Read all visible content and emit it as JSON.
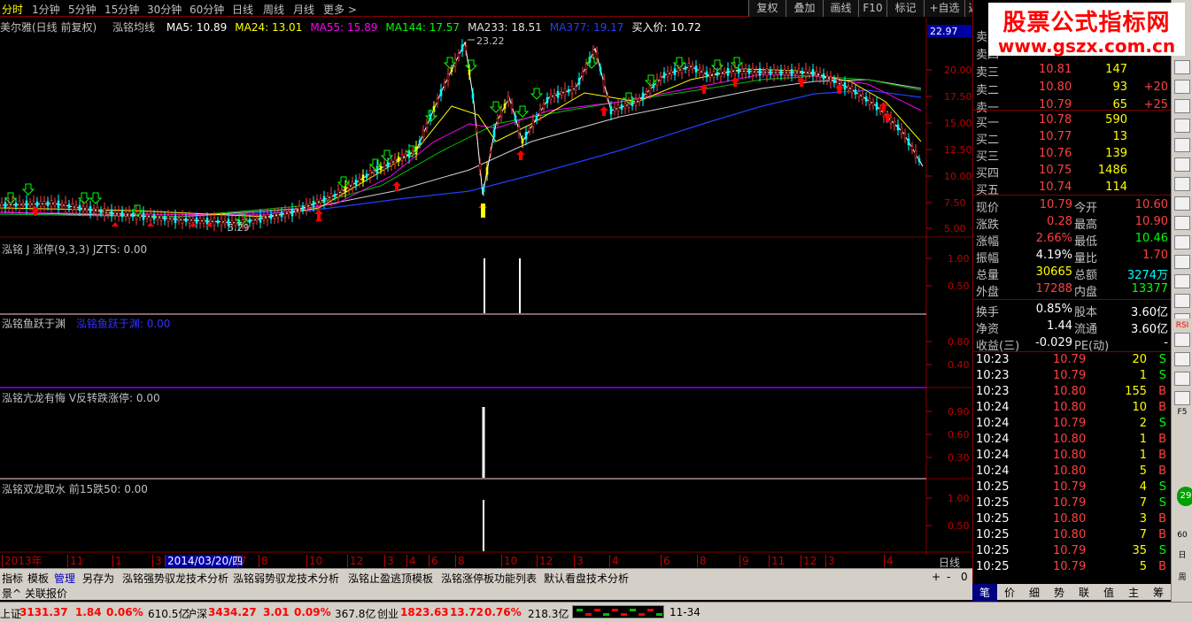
{
  "tabs": [
    {
      "label": "分时"
    },
    {
      "label": "1分钟"
    },
    {
      "label": "5分钟"
    },
    {
      "label": "15分钟"
    },
    {
      "label": "30分钟"
    },
    {
      "label": "60分钟"
    },
    {
      "label": "日线"
    },
    {
      "label": "周线"
    },
    {
      "label": "月线"
    },
    {
      "label": "更多 >"
    }
  ],
  "toolbar": [
    "复权",
    "叠加",
    "画线",
    "F10",
    "标记",
    "+自选",
    "返回"
  ],
  "stock_title": "美尔雅(日线 前复权)",
  "ma_group": "泓铭均线",
  "ma": [
    {
      "text": "MA5: 10.89",
      "color": "#ffffff"
    },
    {
      "text": "MA24: 13.01",
      "color": "#ffff00"
    },
    {
      "text": "MA55: 15.89",
      "color": "#ff00ff"
    },
    {
      "text": "MA144: 17.57",
      "color": "#00ff00"
    },
    {
      "text": "MA233: 18.51",
      "color": "#e0e0e0"
    },
    {
      "text": "MA377: 19.17",
      "color": "#2040ff"
    },
    {
      "text": "买入价: 10.72",
      "color": "#ffffff"
    }
  ],
  "price_scale": {
    "top": "22.97",
    "ticks": [
      "20.00",
      "17.50",
      "15.00",
      "12.50",
      "10.00",
      "7.50",
      "5.00"
    ]
  },
  "high_label": "23.22",
  "low_label": "5.29",
  "sub1": {
    "title": "泓铭 J 涨停(9,3,3)  JZTS: 0.00",
    "ticks": [
      "1.00",
      "0.50"
    ]
  },
  "sub2": {
    "title": "泓铭鱼跃于渊",
    "extra": "泓铭鱼跃于渊: 0.00",
    "ticks": [
      "0.80",
      "0.40"
    ]
  },
  "sub3": {
    "title": "泓铭亢龙有悔   V反转跌涨停: 0.00",
    "ticks": [
      "0.90",
      "0.60",
      "0.30"
    ]
  },
  "sub4": {
    "title": "泓铭双龙取水  前15跌50: 0.00",
    "ticks": [
      "1.00",
      "0.50"
    ]
  },
  "x_axis": [
    "2013年",
    "11",
    "1",
    "3",
    "2014/03/20/四",
    "7",
    "8",
    "10",
    "12",
    "3",
    "4",
    "6",
    "8",
    "10",
    "12",
    "3",
    "4",
    "6",
    "8",
    "9",
    "11",
    "12",
    "3",
    "4"
  ],
  "x_axis_label": "日线",
  "bottom_tabs": [
    "指标",
    "模板",
    "管理",
    "另存为",
    "泓铭强势驭龙技术分析",
    "泓铭弱势驭龙技术分析",
    "泓铭止盈逃顶模板",
    "泓铭涨停板功能列表",
    "默认看盘技术分析"
  ],
  "bottom_tabs2": [
    "景^",
    "关联报价"
  ],
  "nav_ctrl": [
    "+",
    "-",
    "0"
  ],
  "orderbook": {
    "sell": [
      {
        "label": "卖五",
        "price": "",
        "vol": "",
        "chg": ""
      },
      {
        "label": "卖四",
        "price": "",
        "vol": "",
        "chg": ""
      },
      {
        "label": "卖三",
        "price": "10.81",
        "vol": "147",
        "chg": ""
      },
      {
        "label": "卖二",
        "price": "10.80",
        "vol": "93",
        "chg": "+20"
      },
      {
        "label": "卖一",
        "price": "10.79",
        "vol": "65",
        "chg": "+25"
      }
    ],
    "buy": [
      {
        "label": "买一",
        "price": "10.78",
        "vol": "590"
      },
      {
        "label": "买二",
        "price": "10.77",
        "vol": "13"
      },
      {
        "label": "买三",
        "price": "10.76",
        "vol": "139"
      },
      {
        "label": "买四",
        "price": "10.75",
        "vol": "1486"
      },
      {
        "label": "买五",
        "price": "10.74",
        "vol": "114"
      }
    ]
  },
  "quote": [
    {
      "l1": "现价",
      "v1": "10.79",
      "c1": "#ff4040",
      "l2": "今开",
      "v2": "10.60",
      "c2": "#ff4040"
    },
    {
      "l1": "涨跌",
      "v1": "0.28",
      "c1": "#ff4040",
      "l2": "最高",
      "v2": "10.90",
      "c2": "#ff4040"
    },
    {
      "l1": "涨幅",
      "v1": "2.66%",
      "c1": "#ff4040",
      "l2": "最低",
      "v2": "10.46",
      "c2": "#00ff00"
    },
    {
      "l1": "振幅",
      "v1": "4.19%",
      "c1": "#ffffff",
      "l2": "量比",
      "v2": "1.70",
      "c2": "#ff4040"
    },
    {
      "l1": "总量",
      "v1": "30665",
      "c1": "#ffff00",
      "l2": "总额",
      "v2": "3274万",
      "c2": "#00ffff"
    },
    {
      "l1": "外盘",
      "v1": "17288",
      "c1": "#ff4040",
      "l2": "内盘",
      "v2": "13377",
      "c2": "#00ff00"
    },
    {
      "l1": "换手",
      "v1": "0.85%",
      "c1": "#ffffff",
      "l2": "股本",
      "v2": "3.60亿",
      "c2": "#ffffff"
    },
    {
      "l1": "净资",
      "v1": "1.44",
      "c1": "#ffffff",
      "l2": "流通",
      "v2": "3.60亿",
      "c2": "#ffffff"
    },
    {
      "l1": "收益(三)",
      "v1": "-0.029",
      "c1": "#ffffff",
      "l2": "PE(动)",
      "v2": "-",
      "c2": "#ffffff"
    }
  ],
  "ticks": [
    {
      "t": "10:23",
      "p": "10.79",
      "v": "20",
      "s": "S"
    },
    {
      "t": "10:23",
      "p": "10.79",
      "v": "1",
      "s": "S"
    },
    {
      "t": "10:23",
      "p": "10.80",
      "v": "155",
      "s": "B"
    },
    {
      "t": "10:24",
      "p": "10.80",
      "v": "10",
      "s": "B"
    },
    {
      "t": "10:24",
      "p": "10.79",
      "v": "2",
      "s": "S"
    },
    {
      "t": "10:24",
      "p": "10.80",
      "v": "1",
      "s": "B"
    },
    {
      "t": "10:24",
      "p": "10.80",
      "v": "1",
      "s": "B"
    },
    {
      "t": "10:24",
      "p": "10.80",
      "v": "5",
      "s": "B"
    },
    {
      "t": "10:25",
      "p": "10.79",
      "v": "4",
      "s": "S"
    },
    {
      "t": "10:25",
      "p": "10.79",
      "v": "7",
      "s": "S"
    },
    {
      "t": "10:25",
      "p": "10.80",
      "v": "3",
      "s": "B"
    },
    {
      "t": "10:25",
      "p": "10.80",
      "v": "7",
      "s": "B"
    },
    {
      "t": "10:25",
      "p": "10.79",
      "v": "35",
      "s": "S"
    },
    {
      "t": "10:25",
      "p": "10.79",
      "v": "5",
      "s": "B"
    }
  ],
  "right_tabs": [
    "笔",
    "价",
    "细",
    "势",
    "联",
    "值",
    "主",
    "筹"
  ],
  "status": {
    "sh_label": "上证",
    "sh_val": "3131.37",
    "sh_chg": "1.84",
    "sh_pct": "0.06%",
    "sh_amt": "610.5亿",
    "sz_label": "沪深",
    "sz_val": "3434.27",
    "sz_chg": "3.01",
    "sz_pct": "0.09%",
    "sz_amt": "367.8亿",
    "cy_label": "创业",
    "cy_val": "1823.63",
    "cy_chg": "13.72",
    "cy_pct": "0.76%",
    "cy_amt": "218.3亿",
    "code": "11-34"
  },
  "side_icons": [
    "RSI",
    "F5",
    "周",
    "日",
    "60"
  ],
  "logo": {
    "title": "股票公式指标网",
    "url": "www.gszx.com.cn"
  },
  "badge": "29",
  "colors": {
    "up": "#ff4040",
    "down": "#00ff00",
    "frame": "#800000"
  }
}
